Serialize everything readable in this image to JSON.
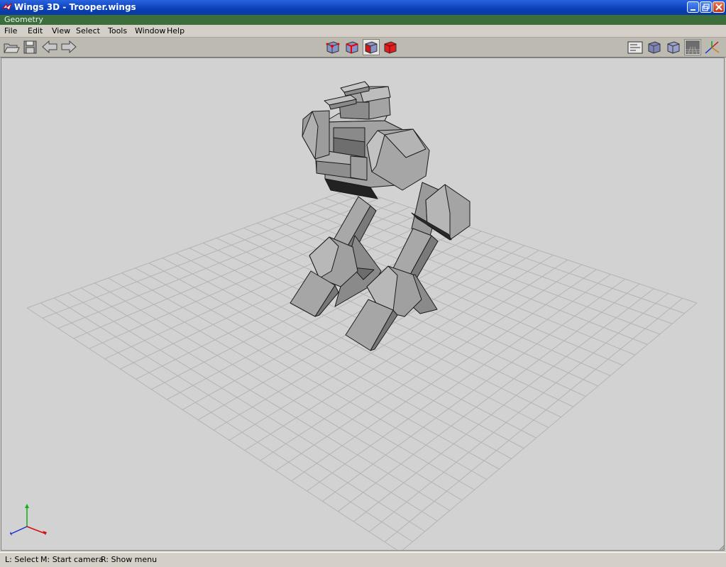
{
  "window": {
    "title": "Wings 3D - Trooper.wings",
    "icon": "wings3d-app-icon",
    "controls": [
      "minimize-icon",
      "maximize-icon",
      "close-icon"
    ]
  },
  "mode_bar": {
    "label": "Geometry"
  },
  "menu": [
    "File",
    "Edit",
    "View",
    "Select",
    "Tools",
    "Window",
    "Help"
  ],
  "toolbar": {
    "left_icons": [
      "open-folder-icon",
      "save-icon",
      "undo-arrow-icon",
      "redo-arrow-icon"
    ],
    "selection_modes": [
      "vertex-select-icon",
      "edge-select-icon",
      "face-select-icon",
      "body-select-icon"
    ],
    "active_selection_mode": "face",
    "right_icons": [
      "groundplane-toggle-icon",
      "smooth-preview-icon",
      "wireframe-icon",
      "perspective-toggle-icon",
      "axes-toggle-icon"
    ]
  },
  "viewport": {
    "background": "#d2d2d2",
    "grid_color": "#b4b4b4",
    "model_color": "#9a9a9a",
    "axis_colors": {
      "x": "#d01010",
      "y": "#10b010",
      "z": "#1030d0"
    }
  },
  "status": {
    "left": "L: Select",
    "middle": "M: Start camera",
    "right": "R: Show menu"
  }
}
